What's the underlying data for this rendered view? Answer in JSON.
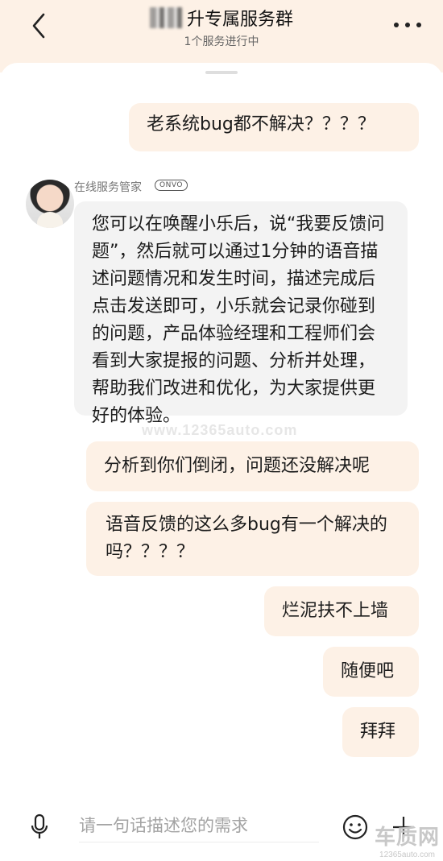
{
  "header": {
    "title": "升专属服务群",
    "subtitle": "1个服务进行中"
  },
  "agent": {
    "name": "在线服务管家",
    "badge": "ONVO"
  },
  "messages": [
    {
      "text": "老系统bug都不解决？？？？"
    },
    {
      "text": "您可以在唤醒小乐后，说“我要反馈问题”，然后就可以通过1分钟的语音描述问题情况和发生时间，描述完成后点击发送即可，小乐就会记录你碰到的问题，产品体验经理和工程师们会看到大家提报的问题、分析并处理，帮助我们改进和优化，为大家提供更好的体验。"
    },
    {
      "text": "分析到你们倒闭，问题还没解决呢"
    },
    {
      "text": "语音反馈的这么多bug有一个解决的吗？？？？"
    },
    {
      "text": "烂泥扶不上墙"
    },
    {
      "text": "随便吧"
    },
    {
      "text": "拜拜"
    }
  ],
  "watermark": "www.12365auto.com",
  "input": {
    "placeholder": "请一句话描述您的需求"
  },
  "logo": {
    "brand": "车质网",
    "site": "12365auto.com"
  },
  "colors": {
    "header_bg": "#fdf1e6",
    "user_bubble": "#fdf1e6",
    "agent_bubble": "#f3f3f3"
  },
  "icons": [
    "back-icon",
    "more-icon",
    "mic-icon",
    "emoji-icon",
    "plus-icon"
  ]
}
